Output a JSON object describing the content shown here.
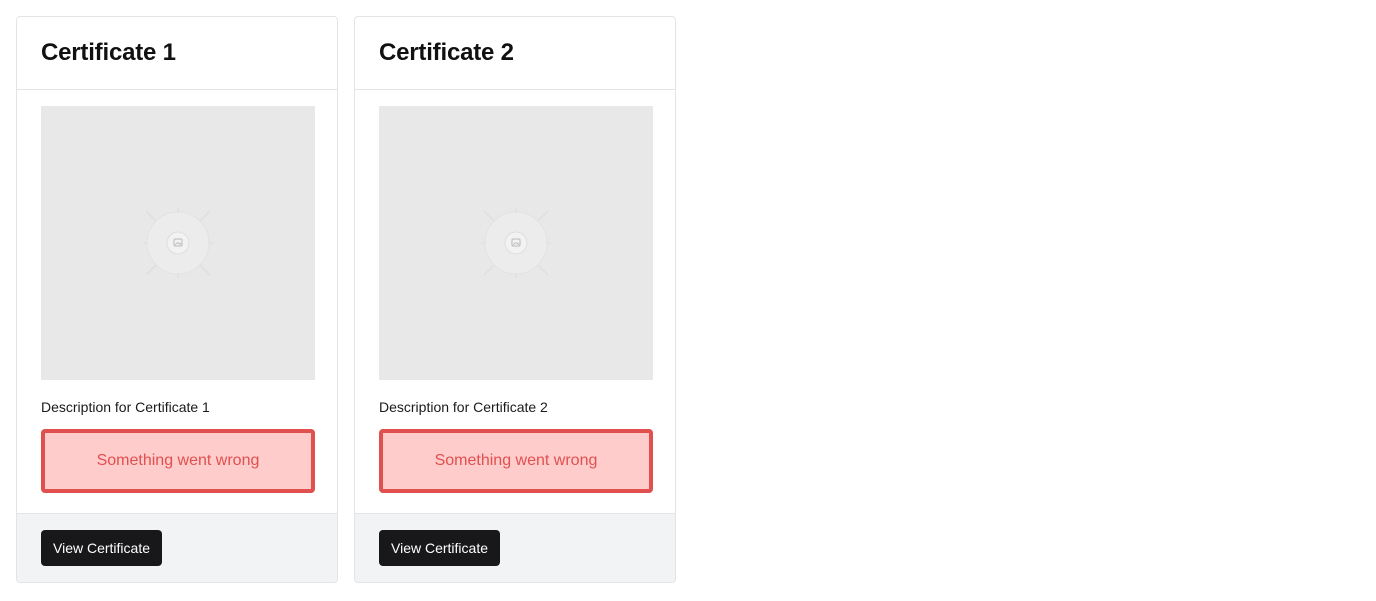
{
  "cards": [
    {
      "title": "Certificate 1",
      "image_icon": "image-placeholder-icon",
      "description": "Description for Certificate 1",
      "error": "Something went wrong",
      "button_label": "View Certificate"
    },
    {
      "title": "Certificate 2",
      "image_icon": "image-placeholder-icon",
      "description": "Description for Certificate 2",
      "error": "Something went wrong",
      "button_label": "View Certificate"
    }
  ],
  "colors": {
    "error_border": "#e0504f",
    "error_background": "#ffcccc",
    "button_background": "#18181b",
    "placeholder_background": "#e8e8e8",
    "footer_background": "#f2f3f5"
  }
}
